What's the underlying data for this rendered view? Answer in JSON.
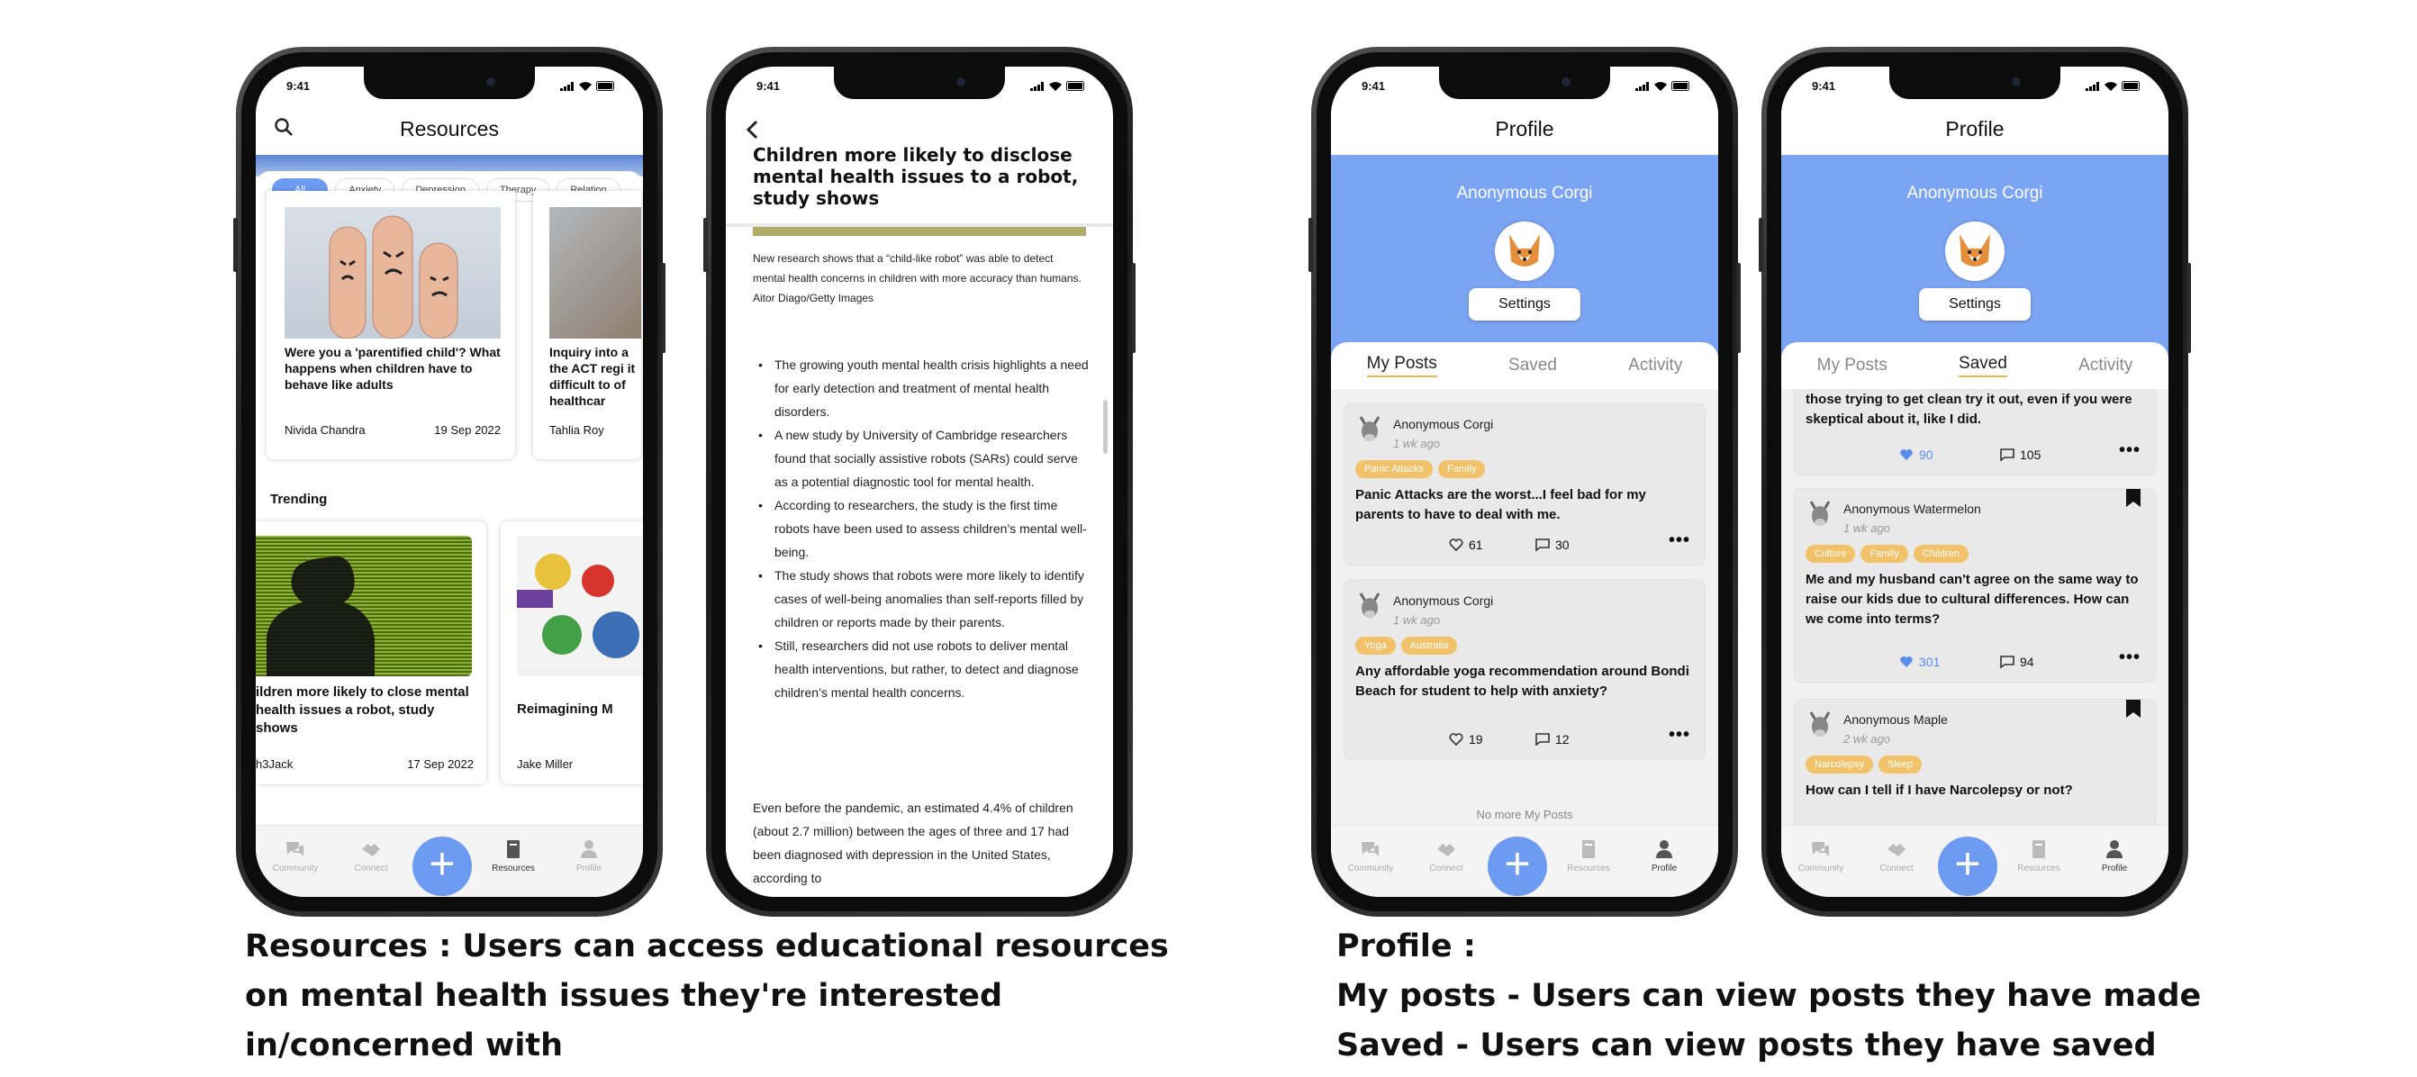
{
  "status_time": "9:41",
  "resources_screen": {
    "title": "Resources",
    "chips": [
      "All",
      "Anxiety",
      "Depression",
      "Therapy",
      "Relation"
    ],
    "cards": [
      {
        "title": "Were you a 'parentified child'? What happens when children have to behave like adults",
        "author": "Nivida Chandra",
        "date": "19 Sep 2022"
      },
      {
        "title": "Inquiry into a the ACT regi it difficult to of healthcar",
        "author": "Tahlia Roy",
        "date": ""
      }
    ],
    "trending_label": "Trending",
    "trending_cards": [
      {
        "title": "ildren more likely to close mental health issues a robot, study shows",
        "author": "h3Jack",
        "date": "17 Sep 2022"
      },
      {
        "title": "Reimagining M",
        "author": "Jake Miller",
        "date": ""
      }
    ]
  },
  "article_screen": {
    "title": "Children more likely to disclose mental health issues to a robot, study shows",
    "caption": "New research shows that a “child-like robot” was able to detect mental health concerns in children with more accuracy than humans. Aitor Diago/Getty Images",
    "bullets": [
      "The growing youth mental health crisis highlights a need for early detection and treatment of mental health disorders.",
      "A new study by University of Cambridge researchers found that socially assistive robots (SARs) could serve as a potential diagnostic tool for mental health.",
      "According to researchers, the study is the first time robots have been used to assess children’s mental well-being.",
      "The study shows that robots were more likely to identify cases of well-being anomalies than self-reports filled by children or reports made by their parents.",
      "Still, researchers did not use robots to deliver mental health interventions, but rather, to detect and diagnose children’s mental health concerns."
    ],
    "paragraph": "Even before the pandemic, an estimated 4.4% of children (about 2.7 million) between the ages of three and 17 had been diagnosed with depression in the United States, according to"
  },
  "tabbar": {
    "community": "Community",
    "connect": "Connect",
    "resources": "Resources",
    "profile": "Profile",
    "fab": "+"
  },
  "profile_myposts": {
    "title": "Profile",
    "username": "Anonymous Corgi",
    "settings": "Settings",
    "tabs": [
      "My Posts",
      "Saved",
      "Activity"
    ],
    "posts": [
      {
        "name": "Anonymous Corgi",
        "time": "1 wk ago",
        "tags": [
          "Panic Attacks",
          "Family"
        ],
        "body": "Panic Attacks are the worst...I feel bad for my parents to have to deal with me.",
        "likes": "61",
        "comments": "30"
      },
      {
        "name": "Anonymous Corgi",
        "time": "1 wk ago",
        "tags": [
          "Yoga",
          "Australia"
        ],
        "body": "Any affordable yoga recommendation around Bondi Beach for student to help with anxiety?",
        "likes": "19",
        "comments": "12"
      }
    ],
    "no_more": "No more My Posts"
  },
  "profile_saved": {
    "title": "Profile",
    "username": "Anonymous Corgi",
    "settings": "Settings",
    "tabs": [
      "My Posts",
      "Saved",
      "Activity"
    ],
    "partial_post": {
      "body": "those trying to get clean try it out, even if you were skeptical about it, like I did.",
      "likes": "90",
      "comments": "105"
    },
    "posts": [
      {
        "name": "Anonymous Watermelon",
        "time": "1 wk ago",
        "tags": [
          "Culture",
          "Family",
          "Children"
        ],
        "body": "Me and my husband can't agree on the same way to raise our kids due to cultural differences. How can we come into terms?",
        "likes": "301",
        "comments": "94"
      },
      {
        "name": "Anonymous Maple",
        "time": "2 wk ago",
        "tags": [
          "Narcolepsy",
          "Sleep"
        ],
        "body": "How can I tell if I have Narcolepsy or not?",
        "likes": "",
        "comments": ""
      }
    ]
  },
  "captions": {
    "resources": "Resources : Users can access educational resources on mental health issues they're interested in/concerned with",
    "profile_line1": "Profile :",
    "profile_line2": "My posts - Users can view posts they have made",
    "profile_line3": "Saved - Users can view posts they have saved"
  },
  "colors": {
    "accent": "#6e9bf2",
    "profile_blue": "#7ba4f2",
    "tag": "#f2c26a",
    "like_blue": "#5b8def"
  }
}
